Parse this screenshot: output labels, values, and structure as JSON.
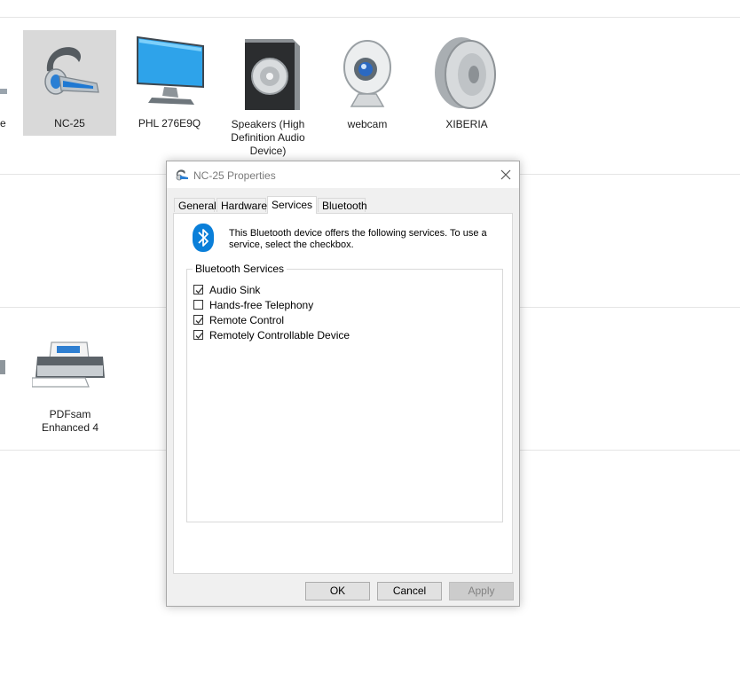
{
  "devices_row1": [
    {
      "label": "e"
    },
    {
      "label": "NC-25",
      "selected": true
    },
    {
      "label": "PHL 276E9Q"
    },
    {
      "label": "Speakers (High Definition Audio Device)",
      "lines": [
        "Speakers (High",
        "Definition Audio",
        "Device)"
      ]
    },
    {
      "label": "webcam"
    },
    {
      "label": "XIBERIA"
    }
  ],
  "devices_row2": [
    {
      "label": "PDFsam Enhanced 4",
      "lines": [
        "PDFsam",
        "Enhanced 4"
      ]
    }
  ],
  "dialog": {
    "title": "NC-25 Properties",
    "tabs": [
      {
        "label": "General",
        "active": false
      },
      {
        "label": "Hardware",
        "active": false
      },
      {
        "label": "Services",
        "active": true
      },
      {
        "label": "Bluetooth",
        "active": false
      }
    ],
    "description_line1": "This Bluetooth device offers the following services. To use a",
    "description_line2": "service, select the checkbox.",
    "group_label": "Bluetooth Services",
    "services": [
      {
        "label": "Audio Sink",
        "checked": true
      },
      {
        "label": "Hands-free Telephony",
        "checked": false
      },
      {
        "label": "Remote Control",
        "checked": true
      },
      {
        "label": "Remotely Controllable Device",
        "checked": true
      }
    ],
    "buttons": {
      "ok": "OK",
      "cancel": "Cancel",
      "apply": "Apply"
    },
    "colors": {
      "bluetooth_blue": "#0a7fd9",
      "check_dark": "#333333"
    }
  }
}
